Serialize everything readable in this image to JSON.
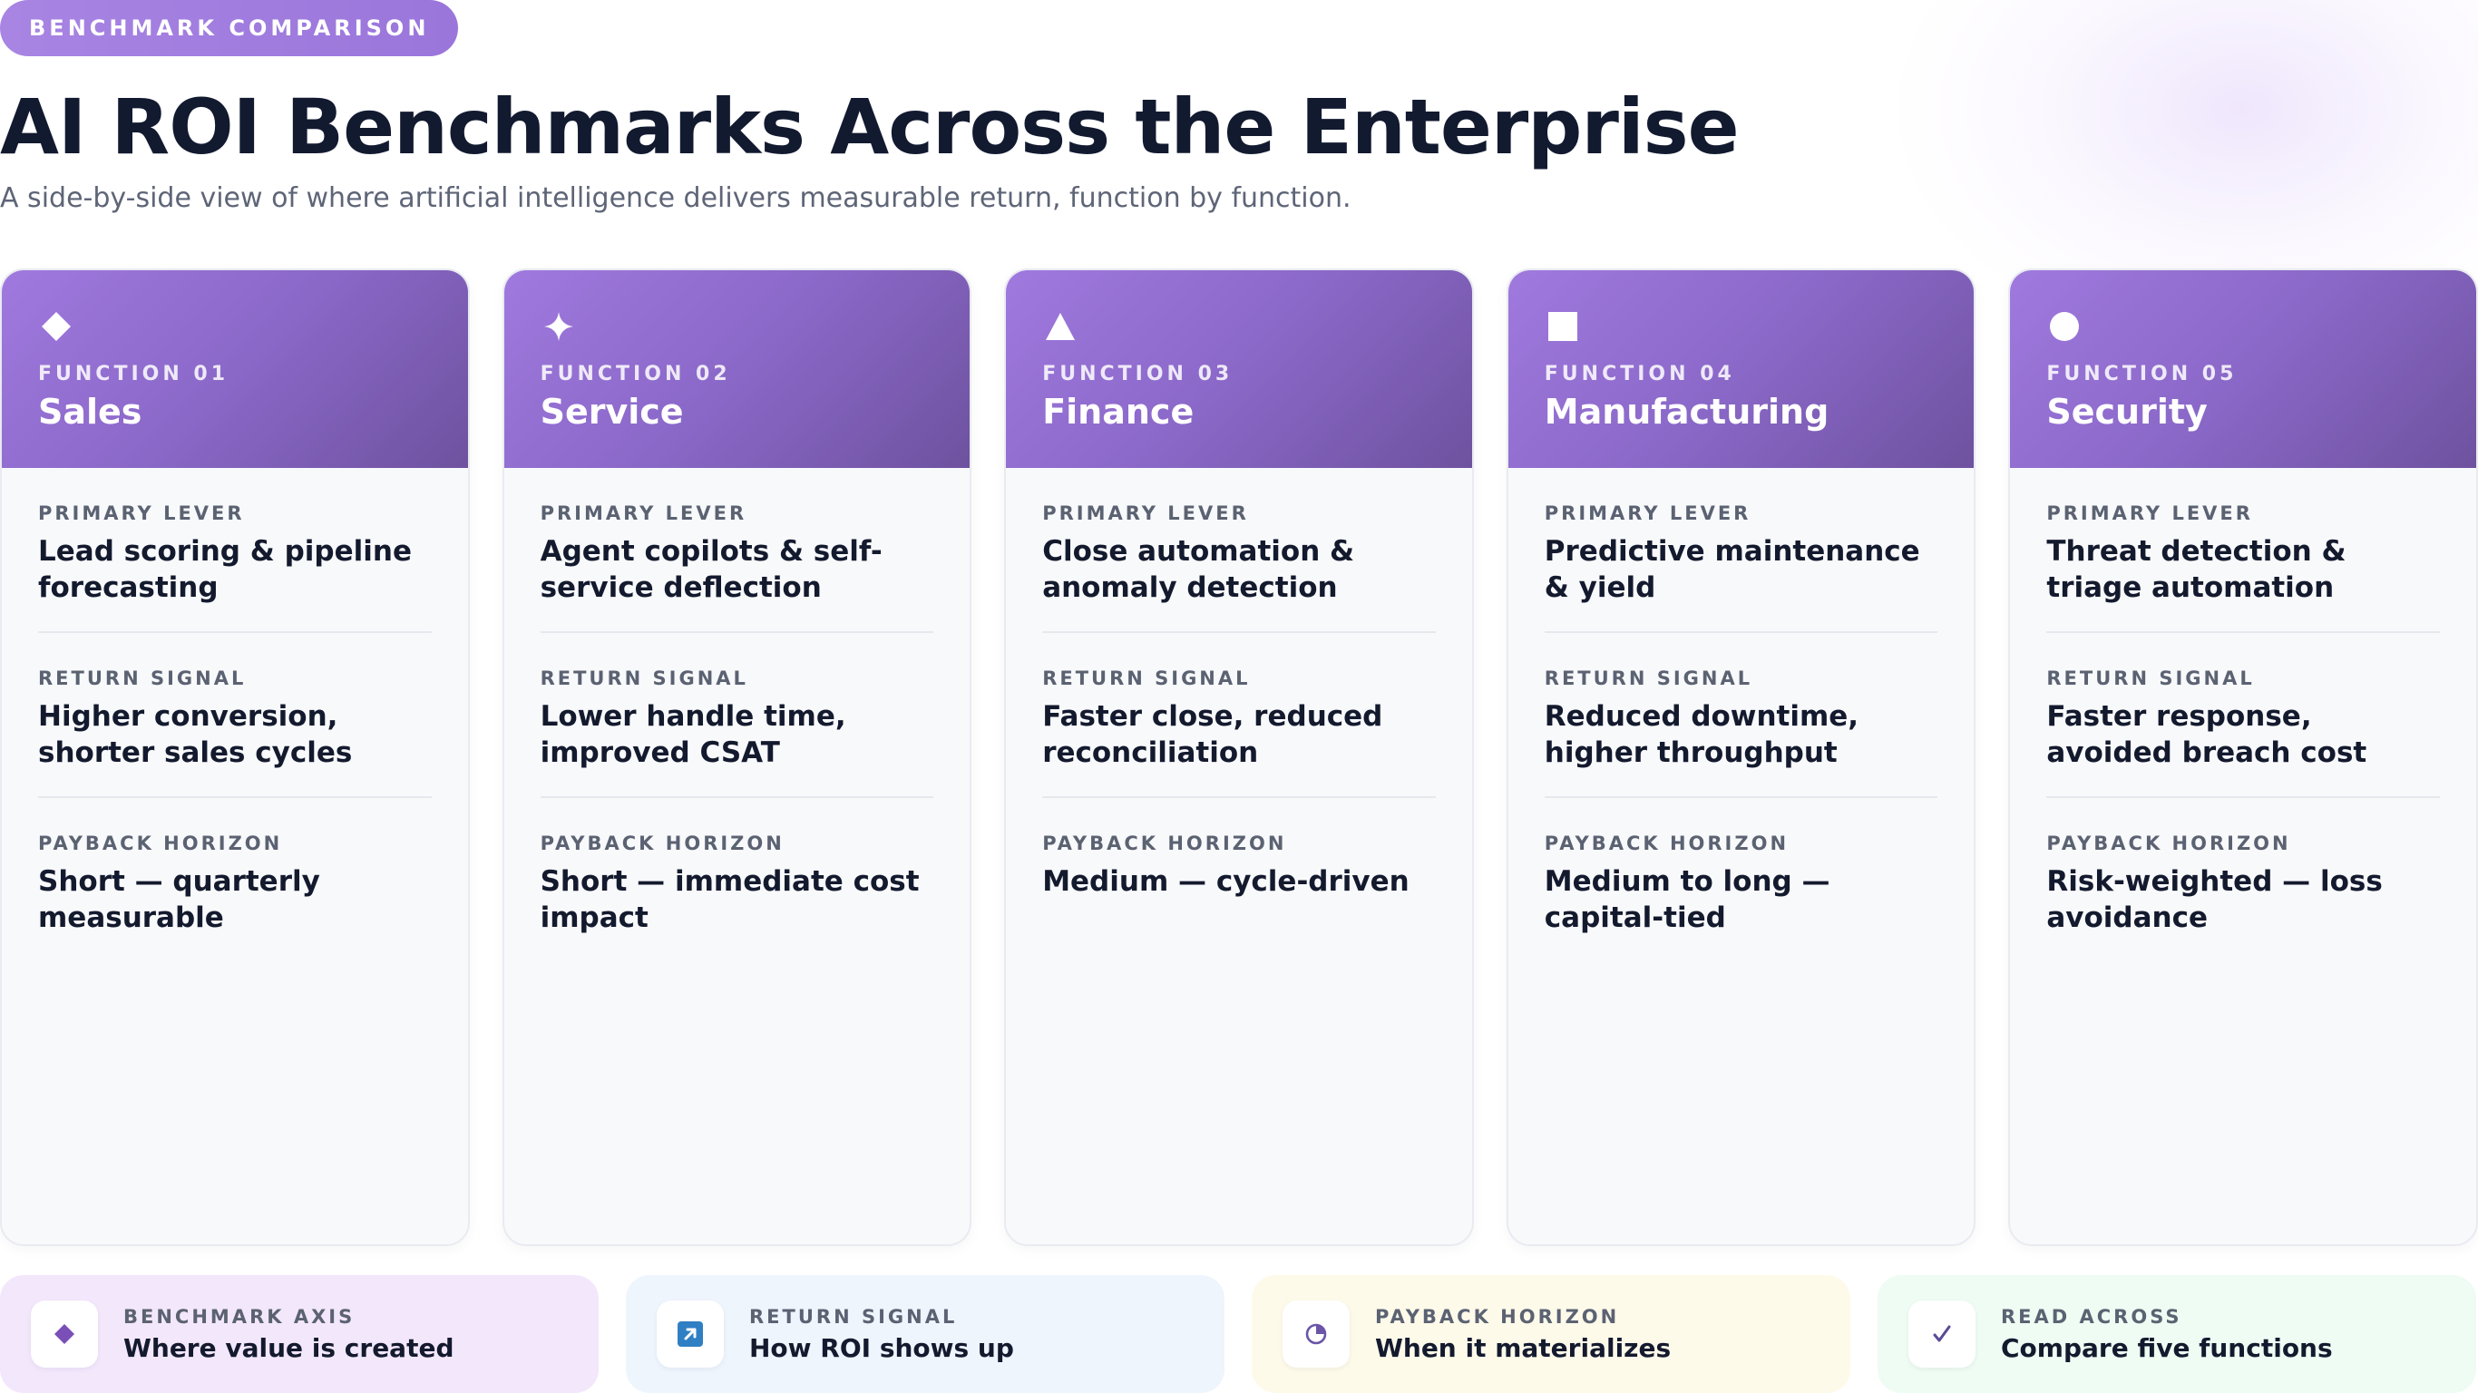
{
  "header": {
    "eyebrow": "BENCHMARK COMPARISON",
    "title": "AI ROI Benchmarks Across the Enterprise",
    "subtitle": "A side-by-side view of where artificial intelligence delivers measurable return, function by function."
  },
  "labels": {
    "primary_lever": "PRIMARY LEVER",
    "return_signal": "RETURN SIGNAL",
    "payback_horizon": "PAYBACK HORIZON"
  },
  "cards": [
    {
      "icon": "diamond-icon",
      "number_label": "FUNCTION 01",
      "name": "Sales",
      "primary_lever": "Lead scoring & pipeline forecasting",
      "return_signal": "Higher conversion, shorter sales cycles",
      "payback_horizon": "Short — quarterly measurable"
    },
    {
      "icon": "sparkle-icon",
      "number_label": "FUNCTION 02",
      "name": "Service",
      "primary_lever": "Agent copilots & self-service deflection",
      "return_signal": "Lower handle time, improved CSAT",
      "payback_horizon": "Short — immediate cost impact"
    },
    {
      "icon": "triangle-icon",
      "number_label": "FUNCTION 03",
      "name": "Finance",
      "primary_lever": "Close automation & anomaly detection",
      "return_signal": "Faster close, reduced reconciliation",
      "payback_horizon": "Medium — cycle-driven"
    },
    {
      "icon": "square-icon",
      "number_label": "FUNCTION 04",
      "name": "Manufacturing",
      "primary_lever": "Predictive maintenance & yield",
      "return_signal": "Reduced downtime, higher throughput",
      "payback_horizon": "Medium to long — capital-tied"
    },
    {
      "icon": "circle-icon",
      "number_label": "FUNCTION 05",
      "name": "Security",
      "primary_lever": "Threat detection & triage automation",
      "return_signal": "Faster response, avoided breach cost",
      "payback_horizon": "Risk-weighted — loss avoidance"
    }
  ],
  "legend": [
    {
      "icon": "diamond-icon",
      "label": "BENCHMARK AXIS",
      "value": "Where value is created",
      "color": "#7a4fb8"
    },
    {
      "icon": "arrow-up-right-icon",
      "label": "RETURN SIGNAL",
      "value": "How ROI shows up",
      "color": "#2f7fc4"
    },
    {
      "icon": "clock-icon",
      "label": "PAYBACK HORIZON",
      "value": "When it materializes",
      "color": "#6b55a8"
    },
    {
      "icon": "check-icon",
      "label": "READ ACROSS",
      "value": "Compare five functions",
      "color": "#5a4a96"
    }
  ],
  "colors": {
    "accent": "#9b77dc",
    "header_dark": "#6e529f",
    "text": "#141a2e",
    "muted": "#5b6272"
  }
}
